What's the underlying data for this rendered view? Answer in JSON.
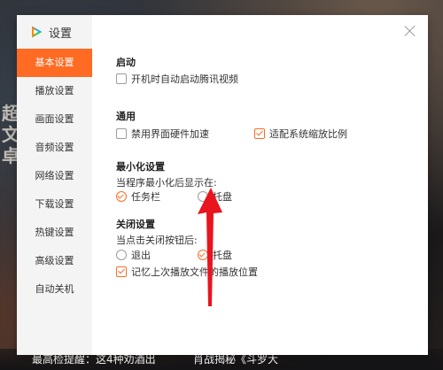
{
  "background": {
    "side_text": [
      "超",
      "文",
      "卓"
    ],
    "bottom_text_left": "最高检提醒：这4种劝酒出",
    "bottom_text_right": "肖战揭秘《斗罗大"
  },
  "dialog": {
    "title": "设置",
    "logo_icon": "tencent-video-logo-icon",
    "close_icon": "close-icon",
    "accent_color": "#ff6b23",
    "nav": [
      {
        "label": "基本设置",
        "active": true
      },
      {
        "label": "播放设置",
        "active": false
      },
      {
        "label": "画面设置",
        "active": false
      },
      {
        "label": "音频设置",
        "active": false
      },
      {
        "label": "网络设置",
        "active": false
      },
      {
        "label": "下载设置",
        "active": false
      },
      {
        "label": "热键设置",
        "active": false
      },
      {
        "label": "高级设置",
        "active": false
      },
      {
        "label": "自动关机",
        "active": false
      }
    ],
    "startup": {
      "title": "启动",
      "autostart_label": "开机时自动启动腾讯视频",
      "autostart_checked": false
    },
    "general": {
      "title": "通用",
      "disable_hw_label": "禁用界面硬件加速",
      "disable_hw_checked": false,
      "adapt_scale_label": "适配系统缩放比例",
      "adapt_scale_checked": true
    },
    "minimize": {
      "title": "最小化设置",
      "prompt": "当程序最小化后显示在:",
      "taskbar_label": "任务栏",
      "taskbar_selected": true,
      "tray_label": "托盘",
      "tray_selected": false
    },
    "close": {
      "title": "关闭设置",
      "prompt": "当点击关闭按钮后:",
      "exit_label": "退出",
      "exit_selected": false,
      "tray_label": "托盘",
      "tray_selected": true,
      "remember_label": "记忆上次播放文件的播放位置",
      "remember_checked": true
    }
  },
  "annotation": {
    "arrow_color": "#e8141e",
    "arrow_icon": "red-arrow-icon"
  }
}
